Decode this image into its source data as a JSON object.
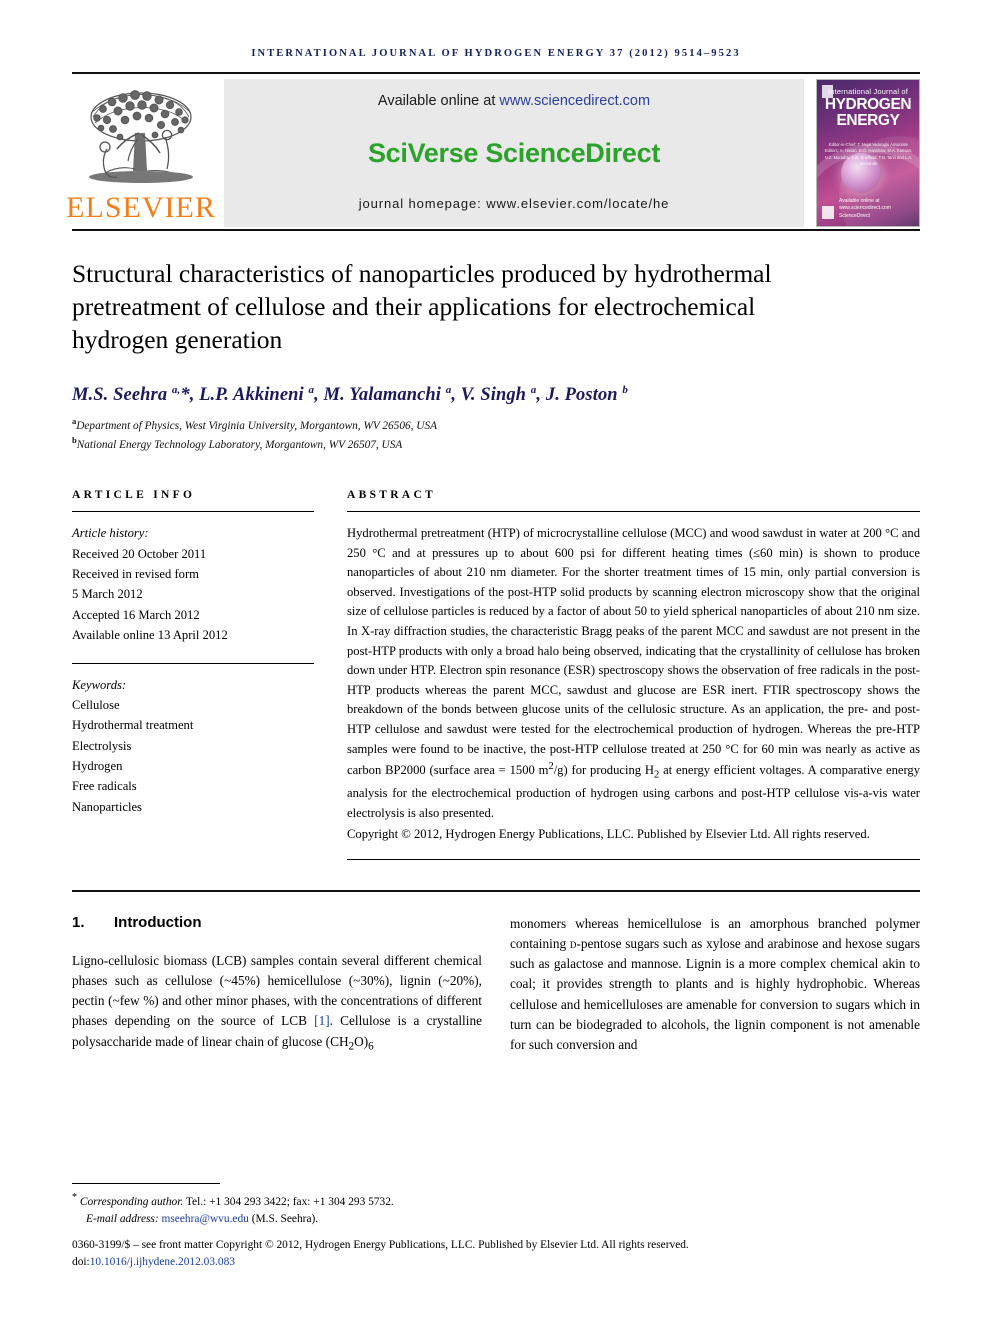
{
  "running_head": "International Journal of Hydrogen Energy 37 (2012) 9514–9523",
  "masthead": {
    "publisher_word": "ELSEVIER",
    "available_prefix": "Available online at ",
    "available_url": "www.sciencedirect.com",
    "sciencedirect_logo": "SciVerse ScienceDirect",
    "journal_homepage": "journal homepage: www.elsevier.com/locate/he",
    "cover": {
      "line1": "International Journal of",
      "line2": "HYDROGEN",
      "line3": "ENERGY",
      "editors": "Editor-in-Chief: T. Nejat Veziroglu   Associate Editors: A. Hasan, D.O. Hanshaw, M.A. Kunsan, N.Z. Muradov, J.W. Sheffield, T.N. Tanri and L.A. Vernande",
      "sciencedirect_badge": "Available online at www.sciencedirect.com  ScienceDirect"
    }
  },
  "article": {
    "title": "Structural characteristics of nanoparticles produced by hydrothermal pretreatment of cellulose and their applications for electrochemical hydrogen generation",
    "authors_html": "M.S. Seehra <sup>a,</sup>*, L.P. Akkineni <sup>a</sup>, M. Yalamanchi <sup>a</sup>, V. Singh <sup>a</sup>, J. Poston <sup>b</sup>",
    "affiliations": [
      {
        "marker": "a",
        "text": "Department of Physics, West Virginia University, Morgantown, WV 26506, USA"
      },
      {
        "marker": "b",
        "text": "National Energy Technology Laboratory, Morgantown, WV 26507, USA"
      }
    ]
  },
  "article_info": {
    "label": "ARTICLE INFO",
    "history_label": "Article history:",
    "history": [
      "Received 20 October 2011",
      "Received in revised form",
      "5 March 2012",
      "Accepted 16 March 2012",
      "Available online 13 April 2012"
    ],
    "keywords_label": "Keywords:",
    "keywords": [
      "Cellulose",
      "Hydrothermal treatment",
      "Electrolysis",
      "Hydrogen",
      "Free radicals",
      "Nanoparticles"
    ]
  },
  "abstract": {
    "label": "ABSTRACT",
    "text": "Hydrothermal pretreatment (HTP) of microcrystalline cellulose (MCC) and wood sawdust in water at 200 °C and 250 °C and at pressures up to about 600 psi for different heating times (≤60 min) is shown to produce nanoparticles of about 210 nm diameter. For the shorter treatment times of 15 min, only partial conversion is observed. Investigations of the post-HTP solid products by scanning electron microscopy show that the original size of cellulose particles is reduced by a factor of about 50 to yield spherical nanoparticles of about 210 nm size. In X-ray diffraction studies, the characteristic Bragg peaks of the parent MCC and sawdust are not present in the post-HTP products with only a broad halo being observed, indicating that the crystallinity of cellulose has broken down under HTP. Electron spin resonance (ESR) spectroscopy shows the observation of free radicals in the post-HTP products whereas the parent MCC, sawdust and glucose are ESR inert. FTIR spectroscopy shows the breakdown of the bonds between glucose units of the cellulosic structure. As an application, the pre- and post-HTP cellulose and sawdust were tested for the electrochemical production of hydrogen. Whereas the pre-HTP samples were found to be inactive, the post-HTP cellulose treated at 250 °C for 60 min was nearly as active as carbon BP2000 (surface area = 1500 m2/g) for producing H2 at energy efficient voltages. A comparative energy analysis for the electrochemical production of hydrogen using carbons and post-HTP cellulose vis-a-vis water electrolysis is also presented.",
    "copyright": "Copyright © 2012, Hydrogen Energy Publications, LLC. Published by Elsevier Ltd. All rights reserved."
  },
  "introduction": {
    "number": "1.",
    "heading": "Introduction",
    "left_column": "Ligno-cellulosic biomass (LCB) samples contain several different chemical phases such as cellulose (~45%) hemicellulose (~30%), lignin (~20%), pectin (~few %) and other minor phases, with the concentrations of different phases depending on the source of LCB [1]. Cellulose is a crystalline polysaccharide made of linear chain of glucose (CH2O)6",
    "left_ref": "[1]",
    "right_column": "monomers whereas hemicellulose is an amorphous branched polymer containing D-pentose sugars such as xylose and arabinose and hexose sugars such as galactose and mannose. Lignin is a more complex chemical akin to coal; it provides strength to plants and is highly hydrophobic. Whereas cellulose and hemicelluloses are amenable for conversion to sugars which in turn can be biodegraded to alcohols, the lignin component is not amenable for such conversion and"
  },
  "footnotes": {
    "corresponding": "Corresponding author. Tel.: +1 304 293 3422; fax: +1 304 293 5732.",
    "corresponding_label": "Corresponding author.",
    "email_label": "E-mail address: ",
    "email": "mseehra@wvu.edu",
    "email_suffix": " (M.S. Seehra).",
    "issn_line": "0360-3199/$ – see front matter Copyright © 2012, Hydrogen Energy Publications, LLC. Published by Elsevier Ltd. All rights reserved.",
    "doi_prefix": "doi:",
    "doi": "10.1016/j.ijhydene.2012.03.083"
  },
  "colors": {
    "elsevier_orange": "#f07f1a",
    "sciencedirect_green": "#2ba32b",
    "link_blue": "#1a3fa0",
    "author_navy": "#1b1b5c",
    "banner_gray": "#e9e9e9"
  }
}
